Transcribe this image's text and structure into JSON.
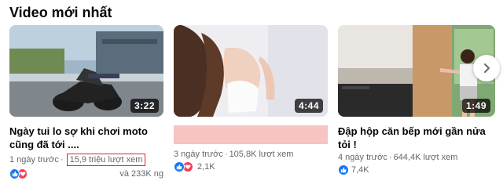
{
  "section": {
    "title": "Video mới nhất"
  },
  "videos": [
    {
      "duration": "3:22",
      "title": "Ngày tui lo sợ khi chơi moto cũng đã tới ....",
      "time": "1 ngày trước",
      "views": "15,9 triệu lượt xem",
      "reactions": "và 233K ng"
    },
    {
      "duration": "4:44",
      "title": "",
      "time": "3 ngày trước",
      "views": "105,8K lượt xem",
      "reactions": "2,1K"
    },
    {
      "duration": "1:49",
      "title": "Đập hộp căn bếp mới gần nửa tỏi !",
      "time": "4 ngày trước",
      "views": "644,4K lượt xem",
      "reactions": "7,4K"
    }
  ],
  "icons": {
    "next": "chevron-right-icon",
    "like": "like-icon",
    "love": "heart-icon"
  },
  "colors": {
    "like": "#1877f2",
    "love": "#f33e58",
    "highlight_box": "#e02424",
    "redaction": "#f7c3c3"
  }
}
